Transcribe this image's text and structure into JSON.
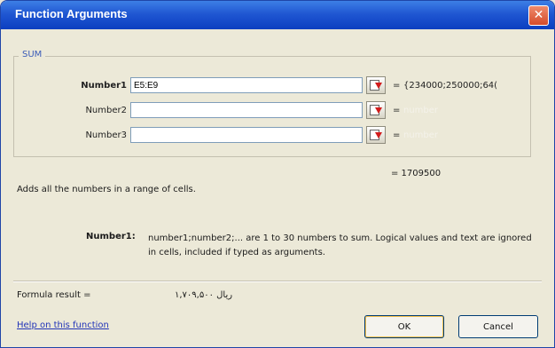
{
  "window": {
    "title": "Function Arguments",
    "close_icon": "close-icon"
  },
  "function_name": "SUM",
  "arguments": [
    {
      "label": "Number1",
      "value": "E5:E9",
      "result": "{234000;250000;64("
    },
    {
      "label": "Number2",
      "value": "",
      "result": "number"
    },
    {
      "label": "Number3",
      "value": "",
      "result": "number"
    }
  ],
  "equals": "=",
  "total_result": "= 1709500",
  "description": "Adds all the numbers in a range of cells.",
  "arg_description": {
    "label": "Number1:",
    "text": "number1;number2;... are 1 to 30 numbers to sum. Logical values and text are ignored in cells, included if typed as arguments."
  },
  "formula": {
    "label": "Formula result =",
    "value": "۱,۷۰۹,۵۰۰ ریال"
  },
  "help_link": "Help on this function",
  "buttons": {
    "ok": "OK",
    "cancel": "Cancel"
  }
}
